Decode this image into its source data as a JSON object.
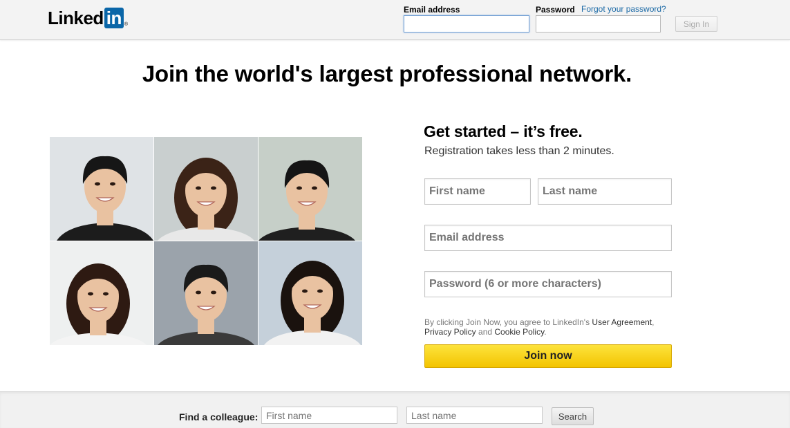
{
  "header": {
    "logo_text": "Linked",
    "logo_in": "in",
    "logo_reg": "®",
    "email_label": "Email address",
    "password_label": "Password",
    "forgot_link": "Forgot your password?",
    "email_value": "",
    "password_value": "",
    "signin_label": "Sign In"
  },
  "hero": {
    "headline": "Join the world's largest professional network."
  },
  "photos": {
    "items": [
      {
        "name": "photo-man-smiling-dark-shirt",
        "bg": "#dfe3e6",
        "shirt": "#1c1c1c",
        "hair": "#161616"
      },
      {
        "name": "photo-woman-bob-haircut",
        "bg": "#c9cfcf",
        "shirt": "#e8e8e8",
        "hair": "#3b2317"
      },
      {
        "name": "photo-man-suit-laughing",
        "bg": "#c6cfc8",
        "shirt": "#1f1f1f",
        "hair": "#151515"
      },
      {
        "name": "photo-woman-long-hair-smiling",
        "bg": "#eef0f0",
        "shirt": "#f4f4f4",
        "hair": "#2e1a12"
      },
      {
        "name": "photo-young-man-scarf",
        "bg": "#9ba3ab",
        "shirt": "#3a3a3a",
        "hair": "#1a1a1a"
      },
      {
        "name": "photo-woman-office-smiling",
        "bg": "#c5d0da",
        "shirt": "#f2f2f2",
        "hair": "#1a120e"
      }
    ]
  },
  "registration": {
    "title": "Get started – it’s free.",
    "subtitle": "Registration takes less than 2 minutes.",
    "first_name_placeholder": "First name",
    "last_name_placeholder": "Last name",
    "email_placeholder": "Email address",
    "password_placeholder": "Password (6 or more characters)",
    "terms_prefix": "By clicking Join Now, you agree to LinkedIn's ",
    "user_agreement": "User Agreement",
    "terms_comma": ",",
    "privacy_policy": "Privacy Policy",
    "terms_and": " and ",
    "cookie_policy": "Cookie Policy",
    "terms_period": ".",
    "join_label": "Join now",
    "join_color": "#f9d419"
  },
  "footer": {
    "find_label": "Find a colleague:",
    "first_name_placeholder": "First name",
    "last_name_placeholder": "Last name",
    "search_label": "Search"
  },
  "colors": {
    "brand_blue": "#0a66a8",
    "link_blue": "#1c6aa6"
  }
}
